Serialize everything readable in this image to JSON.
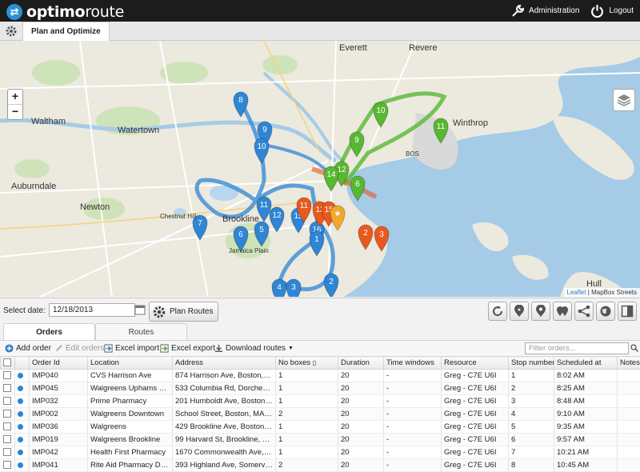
{
  "app": {
    "logo_text_bold": "optimo",
    "logo_text": "route"
  },
  "topnav": {
    "admin": "Administration",
    "logout": "Logout"
  },
  "tabs": {
    "plan": "Plan and Optimize"
  },
  "map": {
    "labels": [
      {
        "text": "Everett"
      },
      {
        "text": "Revere"
      },
      {
        "text": "Waltham"
      },
      {
        "text": "Watertown"
      },
      {
        "text": "Winthrop"
      },
      {
        "text": "Newton"
      },
      {
        "text": "Brookline"
      },
      {
        "text": "Auburndale"
      },
      {
        "text": "Chestnut Hill"
      },
      {
        "text": "Jamaica Plain"
      },
      {
        "text": "Hull"
      },
      {
        "text": "BOS"
      }
    ],
    "zoom_in": "+",
    "zoom_out": "−",
    "attribution_link": "Leaflet",
    "attribution_text": "| MapBox Streets",
    "route_colors": {
      "blue": "#2e86d4",
      "green": "#58b832",
      "orange": "#e8591f",
      "depot": "#f0a92a"
    },
    "markers": [
      {
        "label": "8",
        "color": "blue"
      },
      {
        "label": "9",
        "color": "blue"
      },
      {
        "label": "10",
        "color": "blue"
      },
      {
        "label": "7",
        "color": "blue"
      },
      {
        "label": "6",
        "color": "blue"
      },
      {
        "label": "5",
        "color": "blue"
      },
      {
        "label": "11",
        "color": "blue"
      },
      {
        "label": "12",
        "color": "blue"
      },
      {
        "label": "15",
        "color": "blue"
      },
      {
        "label": "16",
        "color": "blue"
      },
      {
        "label": "1",
        "color": "blue"
      },
      {
        "label": "4",
        "color": "blue"
      },
      {
        "label": "3",
        "color": "blue"
      },
      {
        "label": "2",
        "color": "blue"
      },
      {
        "label": "10",
        "color": "green"
      },
      {
        "label": "11",
        "color": "green"
      },
      {
        "label": "9",
        "color": "green"
      },
      {
        "label": "12",
        "color": "green"
      },
      {
        "label": "14",
        "color": "green"
      },
      {
        "label": "6",
        "color": "green"
      },
      {
        "label": "11",
        "color": "orange"
      },
      {
        "label": "13",
        "color": "orange"
      },
      {
        "label": "15",
        "color": "orange"
      },
      {
        "label": "2",
        "color": "orange"
      },
      {
        "label": "3",
        "color": "orange"
      },
      {
        "label": "★",
        "color": "depot"
      }
    ]
  },
  "controls": {
    "select_date_label": "Select date:",
    "date_value": "12/18/2013",
    "plan_routes": "Plan Routes"
  },
  "panel_tabs": {
    "orders": "Orders",
    "routes": "Routes"
  },
  "toolbar": {
    "add_order": "Add order",
    "edit_orders": "Edit orders",
    "excel_import": "Excel import",
    "excel_export": "Excel export",
    "download_routes": "Download routes",
    "filter_placeholder": "Filter orders..."
  },
  "table": {
    "columns": [
      "Order Id",
      "Location",
      "Address",
      "No boxes",
      "Duration",
      "Time windows",
      "Resource",
      "Stop number",
      "Scheduled at",
      "Notes"
    ],
    "rows": [
      {
        "id": "IMP040",
        "location": "CVS Harrison Ave",
        "address": "874 Harrison Ave, Boston, M...",
        "boxes": "1",
        "duration": "20",
        "tw": "-",
        "resource": "Greg - C7E U6I",
        "stop": "1",
        "sched": "8:02 AM"
      },
      {
        "id": "IMP045",
        "location": "Walgreens Uphams Co...",
        "address": "533 Columbia Rd, Dorcheste...",
        "boxes": "1",
        "duration": "20",
        "tw": "-",
        "resource": "Greg - C7E U6I",
        "stop": "2",
        "sched": "8:25 AM"
      },
      {
        "id": "IMP032",
        "location": "Prime Pharmacy",
        "address": "201 Humboldt Ave, Boston, ...",
        "boxes": "1",
        "duration": "20",
        "tw": "-",
        "resource": "Greg - C7E U6I",
        "stop": "3",
        "sched": "8:48 AM"
      },
      {
        "id": "IMP002",
        "location": "Walgreens Downtown",
        "address": "School Street, Boston, MA, U...",
        "boxes": "2",
        "duration": "20",
        "tw": "-",
        "resource": "Greg - C7E U6I",
        "stop": "4",
        "sched": "9:10 AM"
      },
      {
        "id": "IMP036",
        "location": "Walgreens",
        "address": "429 Brookline Ave, Boston, ...",
        "boxes": "1",
        "duration": "20",
        "tw": "-",
        "resource": "Greg - C7E U6I",
        "stop": "5",
        "sched": "9:35 AM"
      },
      {
        "id": "IMP019",
        "location": "Walgreens Brookline",
        "address": "99 Harvard St, Brookline, MA...",
        "boxes": "1",
        "duration": "20",
        "tw": "-",
        "resource": "Greg - C7E U6I",
        "stop": "6",
        "sched": "9:57 AM"
      },
      {
        "id": "IMP042",
        "location": "Health First Pharmacy",
        "address": "1670 Commonwealth Ave, B...",
        "boxes": "1",
        "duration": "20",
        "tw": "-",
        "resource": "Greg - C7E U6I",
        "stop": "7",
        "sched": "10:21 AM"
      },
      {
        "id": "IMP041",
        "location": "Rite Aid Pharmacy Dav...",
        "address": "393 Highland Ave, Somerville...",
        "boxes": "2",
        "duration": "20",
        "tw": "-",
        "resource": "Greg - C7E U6I",
        "stop": "8",
        "sched": "10:45 AM"
      }
    ]
  }
}
